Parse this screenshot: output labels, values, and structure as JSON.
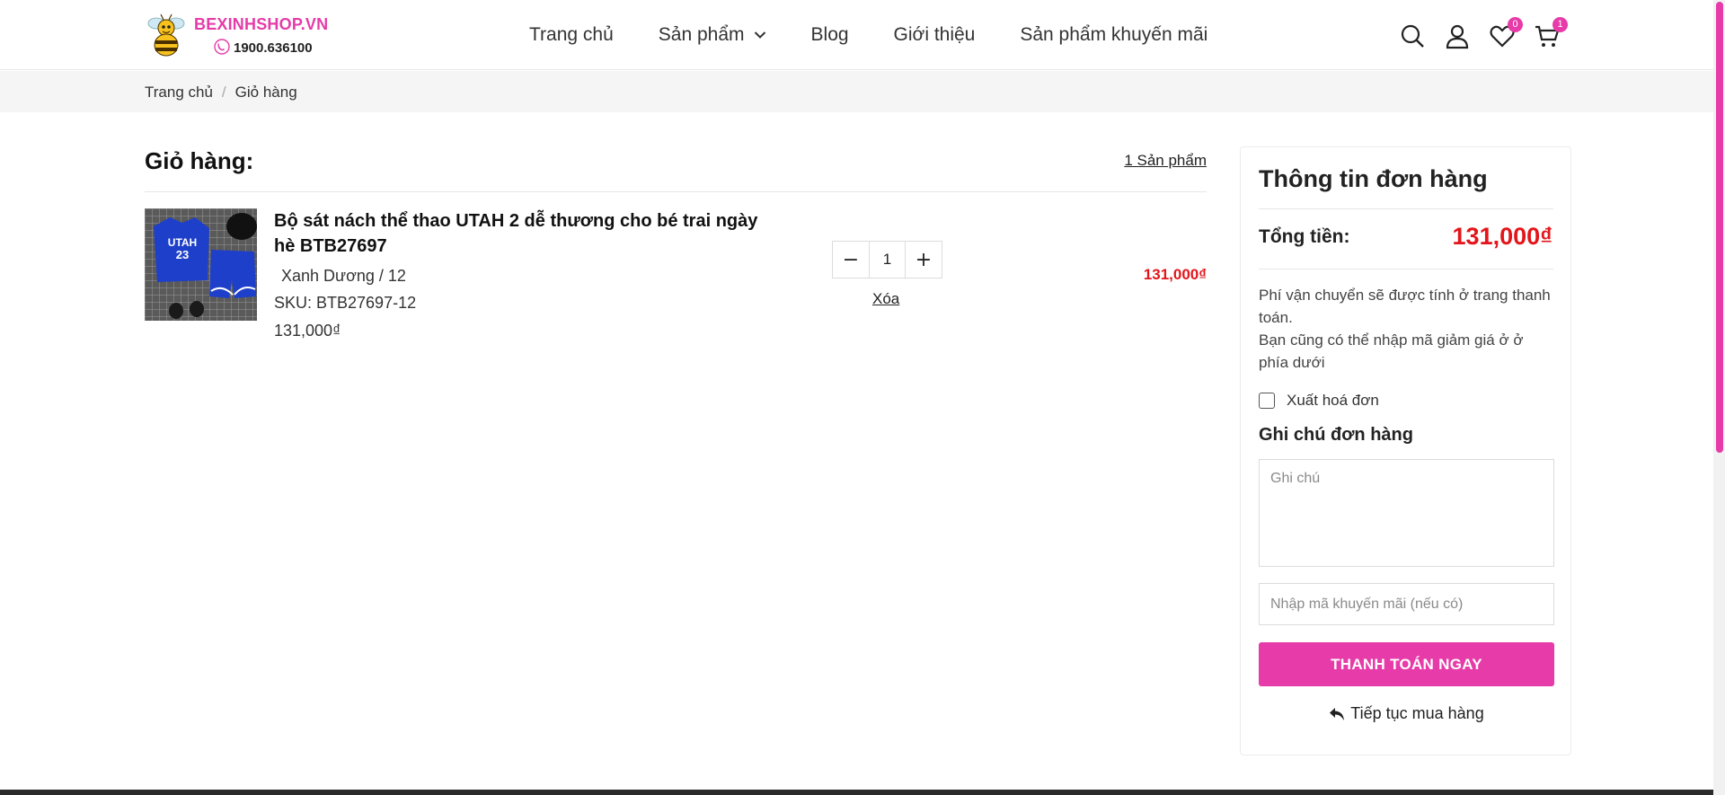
{
  "header": {
    "brand": "BEXINHSHOP.VN",
    "phone": "1900.636100",
    "nav": [
      "Trang chủ",
      "Sản phẩm",
      "Blog",
      "Giới thiệu",
      "Sản phẩm khuyến mãi"
    ],
    "wishlist_count": "0",
    "cart_count": "1",
    "icons": [
      "search-icon",
      "user-icon",
      "heart-icon",
      "cart-icon"
    ]
  },
  "breadcrumb": {
    "home": "Trang chủ",
    "sep": "/",
    "current": "Giỏ hàng"
  },
  "cart": {
    "title": "Giỏ hàng:",
    "count_label": "1 Sản phẩm",
    "item": {
      "name": "Bộ sát nách thể thao UTAH 2 dễ thương cho bé trai ngày hè BTB27697",
      "variant": "Xanh Dương / 12",
      "sku": "SKU: BTB27697-12",
      "price": "131,000₫",
      "quantity": "1",
      "minus": "−",
      "plus": "+",
      "remove": "Xóa",
      "line_total": "131,000₫",
      "jersey_text": "UTAH",
      "jersey_number": "23"
    }
  },
  "summary": {
    "title": "Thông tin đơn hàng",
    "total_label": "Tổng tiền:",
    "total_value": "131,000₫",
    "shipping_note": "Phí vận chuyển sẽ được tính ở trang thanh toán.",
    "coupon_note": "Bạn cũng có thể nhập mã giảm giá ở ở phía dưới",
    "invoice_label": "Xuất hoá đơn",
    "note_title": "Ghi chú đơn hàng",
    "note_placeholder": "Ghi chú",
    "promo_placeholder": "Nhập mã khuyến mãi (nếu có)",
    "checkout_label": "THANH TOÁN NGAY",
    "continue_label": "Tiếp tục mua hàng"
  },
  "colors": {
    "brand_pink": "#e63ba8",
    "price_red": "#e3151a"
  }
}
